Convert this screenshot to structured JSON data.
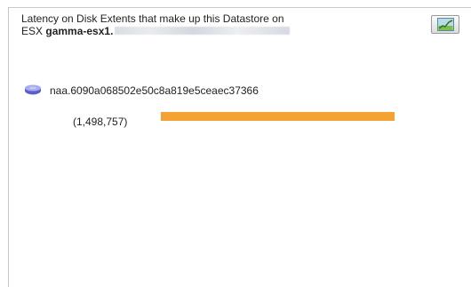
{
  "header": {
    "title_line1": "Latency on Disk Extents that make up this Datastore on",
    "title_prefix": "ESX",
    "host_name": "gamma-esx1."
  },
  "toolbar": {
    "chart_button_icon": "chart-view-icon"
  },
  "extents": [
    {
      "icon": "disk-icon",
      "name": "naa.6090a068502e50c8a819e5ceaec37366",
      "latency_label": "(1,498,757)",
      "bar_fraction": 1.0,
      "bar_color": "#f4a233"
    }
  ]
}
